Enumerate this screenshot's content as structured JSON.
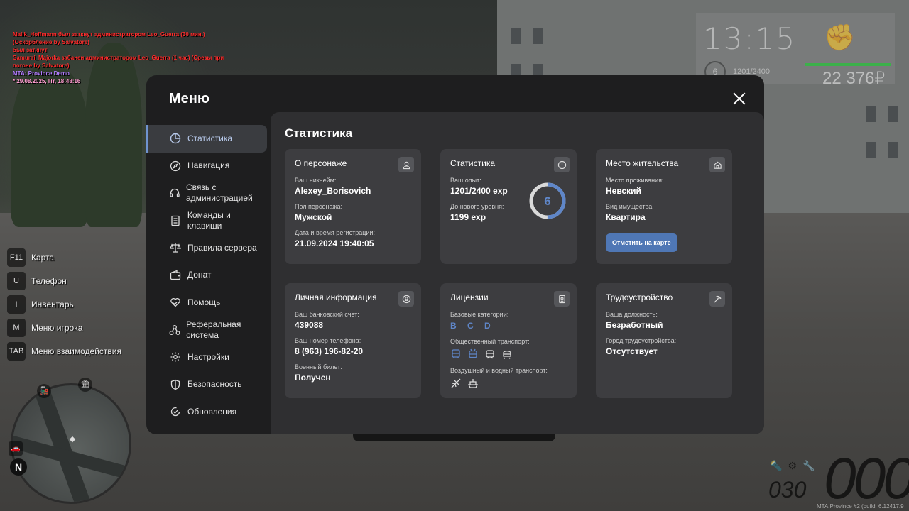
{
  "chat": [
    {
      "text": "Malik_Hoffmann был заткнут администратором Leo_Guerra (30 мин.) (Оскорбление by Salvatore)",
      "color": "red"
    },
    {
      "text": "    был заткнут",
      "color": "red"
    },
    {
      "text": "Samurai_Majorka забанен администратором Leo_Guerra (1 час) (Срезы при погоне by Salvatore)",
      "color": "red"
    },
    {
      "text": "MTA: Province Demo",
      "color": "purple"
    },
    {
      "text": " * 29.08.2025, Пт, 18:48:16",
      "color": "pink"
    }
  ],
  "hud": {
    "time": "13:15",
    "level": "6",
    "exp": "1201/2400",
    "money": "22 376₽"
  },
  "keys": [
    {
      "key": "F11",
      "label": "Карта"
    },
    {
      "key": "U",
      "label": "Телефон"
    },
    {
      "key": "I",
      "label": "Инвентарь"
    },
    {
      "key": "M",
      "label": "Меню игрока"
    },
    {
      "key": "TAB",
      "label": "Меню взаимодействия"
    }
  ],
  "minimap": {
    "north": "N"
  },
  "speedometer": {
    "speed": "000",
    "fuel": "030",
    "build": "MTA:Province #2 (build: 6.12417.9"
  },
  "menu": {
    "title": "Меню",
    "nav": [
      {
        "label": "Статистика",
        "icon": "pie-chart-icon",
        "active": true
      },
      {
        "label": "Навигация",
        "icon": "compass-icon"
      },
      {
        "label": "Связь с администрацией",
        "icon": "headset-icon"
      },
      {
        "label": "Команды и клавиши",
        "icon": "document-icon"
      },
      {
        "label": "Правила сервера",
        "icon": "scales-icon"
      },
      {
        "label": "Донат",
        "icon": "wallet-icon"
      },
      {
        "label": "Помощь",
        "icon": "heart-hand-icon"
      },
      {
        "label": "Реферальная система",
        "icon": "referral-icon"
      },
      {
        "label": "Настройки",
        "icon": "gear-icon"
      },
      {
        "label": "Безопасность",
        "icon": "shield-icon"
      },
      {
        "label": "Обновления",
        "icon": "update-icon"
      }
    ],
    "content_title": "Статистика",
    "cards": {
      "character": {
        "title": "О персонаже",
        "nickname_label": "Ваш никнейм:",
        "nickname": "Alexey_Borisovich",
        "gender_label": "Пол персонажа:",
        "gender": "Мужской",
        "reg_label": "Дата и время регистрации:",
        "reg": "21.09.2024 19:40:05"
      },
      "stats": {
        "title": "Статистика",
        "exp_label": "Ваш опыт:",
        "exp": "1201/2400 exp",
        "next_label": "До нового уровня:",
        "next": "1199 exp",
        "level": "6",
        "progress": 0.5
      },
      "residence": {
        "title": "Место жительства",
        "place_label": "Место проживания:",
        "place": "Невский",
        "property_label": "Вид имущества:",
        "property": "Квартира",
        "button": "Отметить на карте"
      },
      "personal": {
        "title": "Личная информация",
        "bank_label": "Ваш банковский счет:",
        "bank": "439088",
        "phone_label": "Ваш номер телефона:",
        "phone": "8 (963) 196-82-20",
        "military_label": "Военный билет:",
        "military": "Получен"
      },
      "licenses": {
        "title": "Лицензии",
        "base_label": "Базовые категории:",
        "base": "B C D",
        "public_label": "Общественный транспорт:",
        "air_label": "Воздушный и водный транспорт:"
      },
      "employment": {
        "title": "Трудоустройство",
        "position_label": "Ваша должность:",
        "position": "Безработный",
        "city_label": "Город трудоустройства:",
        "city": "Отсутствует"
      }
    }
  },
  "colors": {
    "accent": "#4f77b5",
    "ring_fill": "#5f86c8",
    "ring_track": "#d9d9d9"
  }
}
